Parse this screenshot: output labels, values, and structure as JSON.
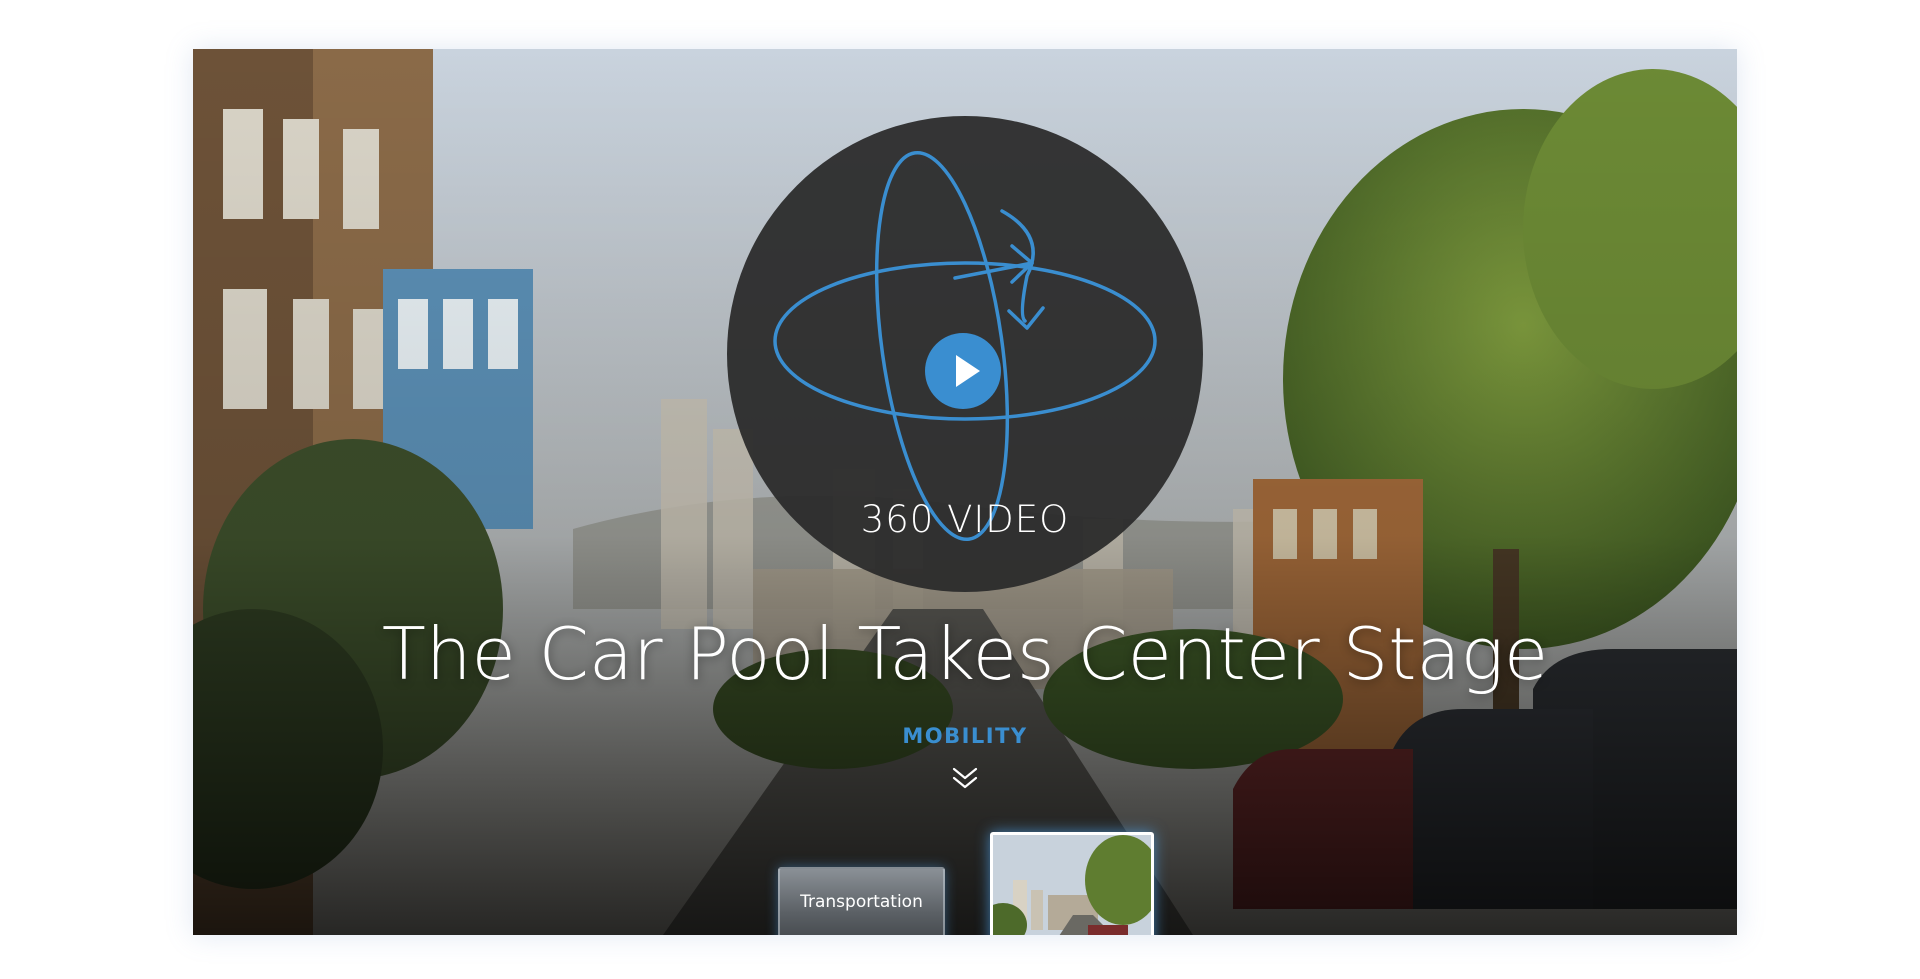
{
  "video_badge": {
    "label": "360 VIDEO",
    "icon": "360-rotation-icon",
    "play_icon": "play-icon"
  },
  "headline": {
    "title": "The Car Pool Takes Center Stage",
    "category": "MOBILITY",
    "scroll_icon": "double-chevron-down-icon"
  },
  "thumbnails": [
    {
      "label": "Transportation",
      "state": "inactive"
    },
    {
      "label": "",
      "state": "active"
    }
  ],
  "colors": {
    "accent": "#3a8ed0",
    "badge_bg": "#2a2a2a",
    "text": "#ffffff"
  }
}
